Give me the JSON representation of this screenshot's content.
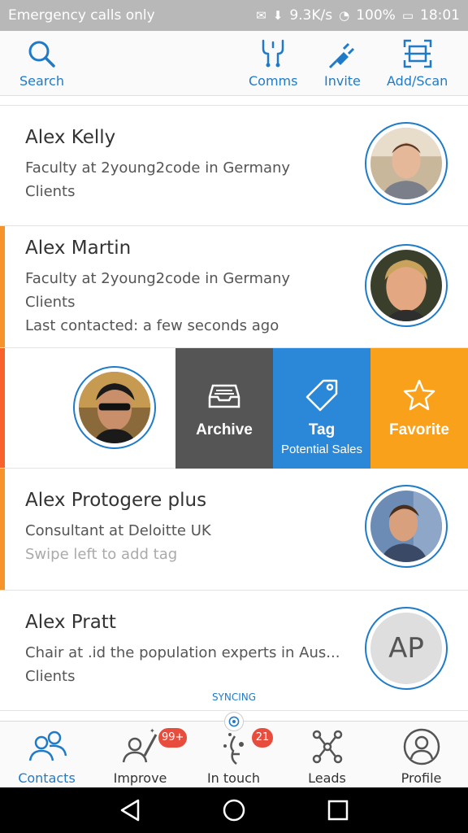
{
  "status_bar": {
    "left_text": "Emergency calls only",
    "speed": "9.3K/s",
    "battery": "100%",
    "time": "18:01"
  },
  "toolbar": {
    "search": "Search",
    "comms": "Comms",
    "invite": "Invite",
    "add_scan": "Add/Scan"
  },
  "contacts": [
    {
      "name": "Alex Kelly",
      "lines": [
        "Faculty at 2young2code in Germany",
        "Clients"
      ]
    },
    {
      "name": "Alex Martin",
      "lines": [
        "Faculty at 2young2code in Germany",
        "Clients",
        "Last contacted: a few seconds ago"
      ]
    },
    {
      "name": "Alex Protogere plus",
      "lines": [
        "Consultant at Deloitte UK"
      ],
      "hint": "Swipe left to add tag"
    },
    {
      "name": "Alex Pratt",
      "lines": [
        "Chair at .id the population experts in Aus...",
        "Clients"
      ],
      "initials": "AP"
    }
  ],
  "swipe_actions": {
    "archive": "Archive",
    "tag": "Tag",
    "tag_sub": "Potential Sales",
    "favorite": "Favorite"
  },
  "sync_label": "SYNCING",
  "bottom_nav": {
    "contacts": "Contacts",
    "improve": "Improve",
    "improve_badge": "99+",
    "in_touch": "In touch",
    "in_touch_badge": "21",
    "leads": "Leads",
    "profile": "Profile"
  },
  "colors": {
    "accent_blue": "#1f7bc8",
    "archive_gray": "#555555",
    "tag_blue": "#2b88d9",
    "favorite_orange": "#f9a11b",
    "row_accent": "#f7932b",
    "badge_red": "#e84c3d"
  }
}
